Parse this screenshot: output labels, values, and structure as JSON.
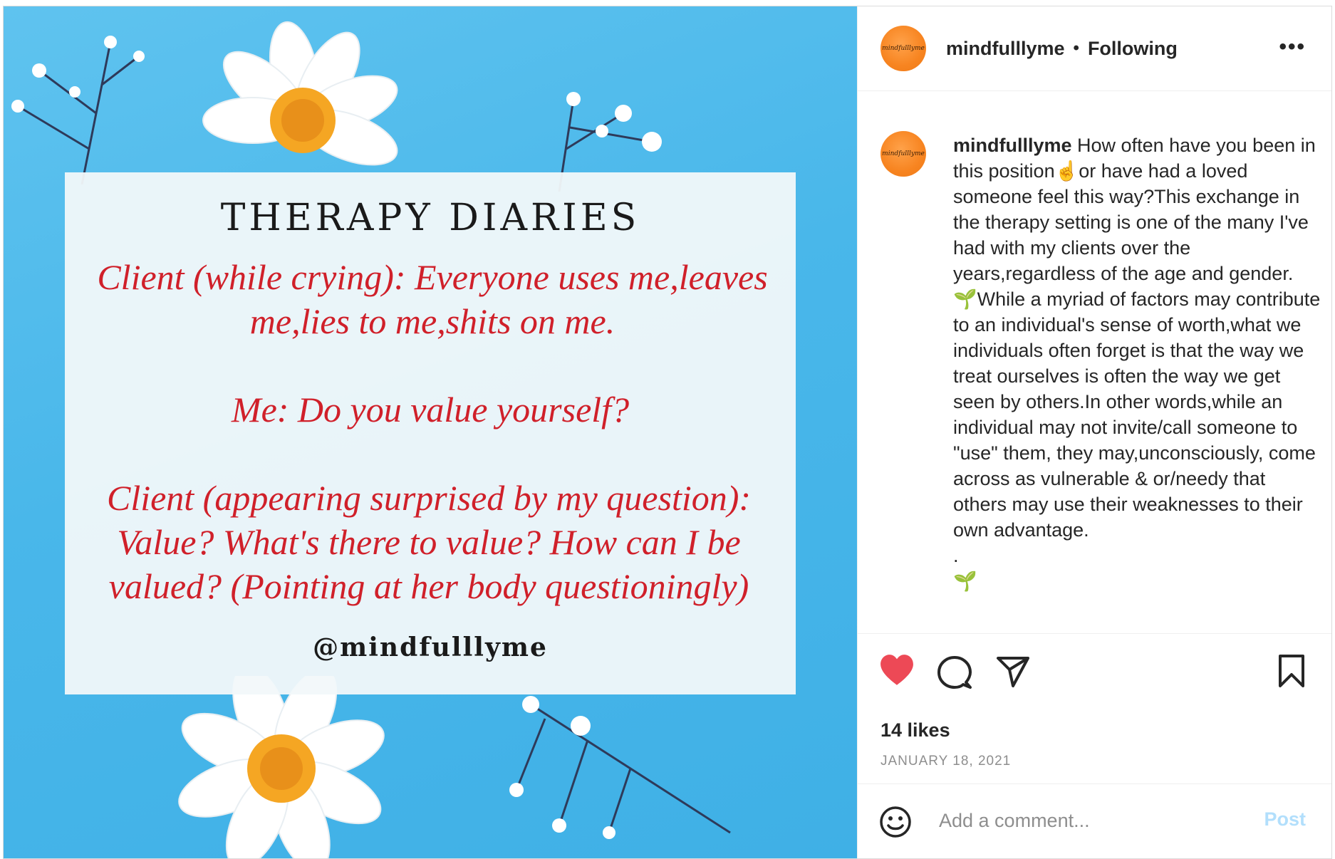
{
  "media": {
    "title": "THERAPY DIARIES",
    "quote_1": "Client (while crying): Everyone uses me,leaves me,lies to me,shits on me.",
    "quote_2": "Me: Do you value yourself?",
    "quote_3": "Client (appearing surprised by my question): Value? What's there to value? How can I be valued? (Pointing at her body questioningly)",
    "handle": "@mindfulllyme"
  },
  "header": {
    "avatar_text": "mindfulllyme",
    "username": "mindfulllyme",
    "separator": "•",
    "follow_status": "Following",
    "more_icon": "more-horizontal-icon"
  },
  "caption": {
    "avatar_text": "mindfulllyme",
    "username": "mindfulllyme",
    "text": " How often have you been in this position☝️or have had a loved someone feel this way?This exchange in the therapy setting is one of the many I've had with my clients over the years,regardless of the age and gender.\n🌱While a myriad of factors may contribute to an individual's sense of worth,what we individuals often forget is that the way we treat ourselves is often the way we get seen by others.In other words,while an individual may not invite/call someone to \"use\" them, they may,unconsciously, come across as vulnerable & or/needy that others may use their weaknesses to their own advantage.\n.\n🌱"
  },
  "actions": {
    "like_icon": "heart-filled-icon",
    "comment_icon": "comment-bubble-icon",
    "share_icon": "paper-plane-icon",
    "save_icon": "bookmark-icon",
    "likes": "14 likes",
    "date": "JANUARY 18, 2021",
    "like_color": "#ed4956"
  },
  "comment": {
    "emoji_icon": "smiley-icon",
    "placeholder": "Add a comment...",
    "post_label": "Post",
    "post_color": "#b2dffc"
  }
}
